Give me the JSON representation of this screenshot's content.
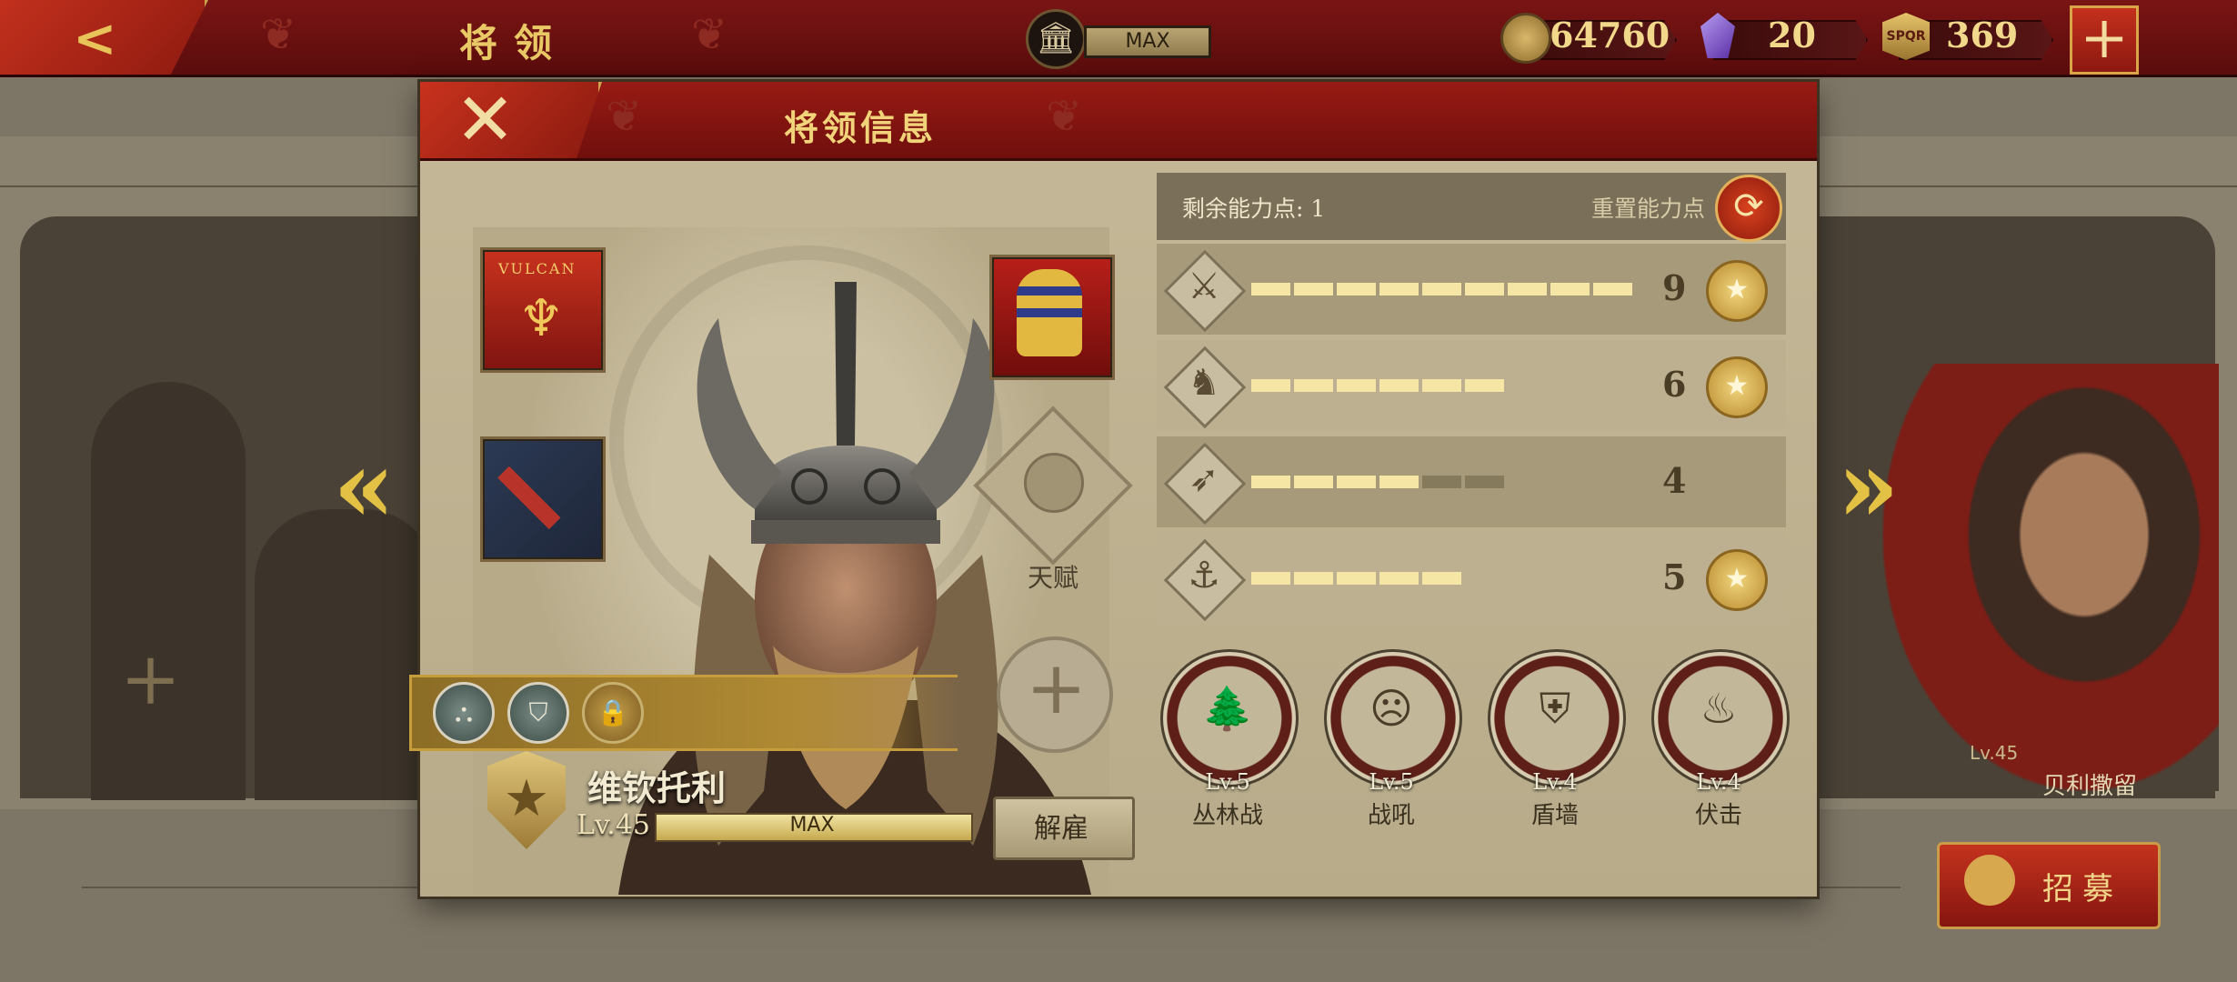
{
  "topbar": {
    "title": "将领",
    "building_status": "MAX",
    "resources": [
      {
        "icon": "coin-icon",
        "value": "64760"
      },
      {
        "icon": "purple-gem-icon",
        "value": "20"
      },
      {
        "icon": "spqr-badge-icon",
        "value": "369"
      }
    ],
    "add_icon": "plus-icon"
  },
  "background": {
    "right_hero": {
      "name": "贝利撒留",
      "level": "Lv.45"
    }
  },
  "recruit": {
    "label": "招募"
  },
  "modal": {
    "title": "将领信息",
    "equipment": {
      "banner_text": "VULCAN"
    },
    "talent_label": "天赋",
    "hero": {
      "name": "维钦托利",
      "level": "Lv.45",
      "xp_label": "MAX",
      "xp_fraction": 1.0
    },
    "dismiss_label": "解雇",
    "points": {
      "label": "剩余能力点: 1",
      "reset_label": "重置能力点"
    },
    "stats": [
      {
        "icon": "sword-icon",
        "value": "9",
        "filled": 9,
        "max": 9,
        "badge": true
      },
      {
        "icon": "horse-icon",
        "value": "6",
        "filled": 6,
        "max": 6,
        "badge": true
      },
      {
        "icon": "bow-icon",
        "value": "4",
        "filled": 4,
        "max": 6,
        "badge": false
      },
      {
        "icon": "anchor-icon",
        "value": "5",
        "filled": 5,
        "max": 5,
        "badge": true
      }
    ],
    "skills": [
      {
        "level": "Lv.5",
        "name": "丛林战",
        "icon": "forest-icon"
      },
      {
        "level": "Lv.5",
        "name": "战吼",
        "icon": "war-cry-icon"
      },
      {
        "level": "Lv.4",
        "name": "盾墙",
        "icon": "shield-wall-icon"
      },
      {
        "level": "Lv.4",
        "name": "伏击",
        "icon": "ambush-icon"
      }
    ]
  },
  "colors": {
    "header_red": "#7a1414",
    "gold": "#e9c866",
    "parchment": "#c4b898"
  }
}
